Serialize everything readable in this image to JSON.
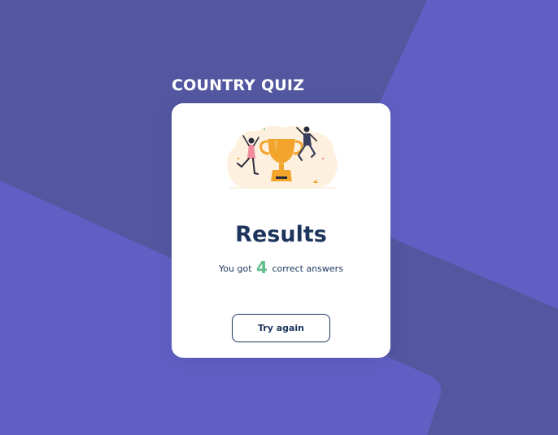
{
  "app": {
    "title": "COUNTRY QUIZ"
  },
  "results": {
    "heading": "Results",
    "prefix": "You got",
    "score": "4",
    "suffix": "correct answers",
    "try_again_label": "Try again"
  },
  "colors": {
    "background": "#6060c4",
    "background_shape": "#5257a0",
    "card": "#ffffff",
    "heading": "#1d355d",
    "score_accent": "#60bf88",
    "trophy": "#f2a42c"
  },
  "icons": {
    "illustration": "winners-trophy-illustration"
  }
}
